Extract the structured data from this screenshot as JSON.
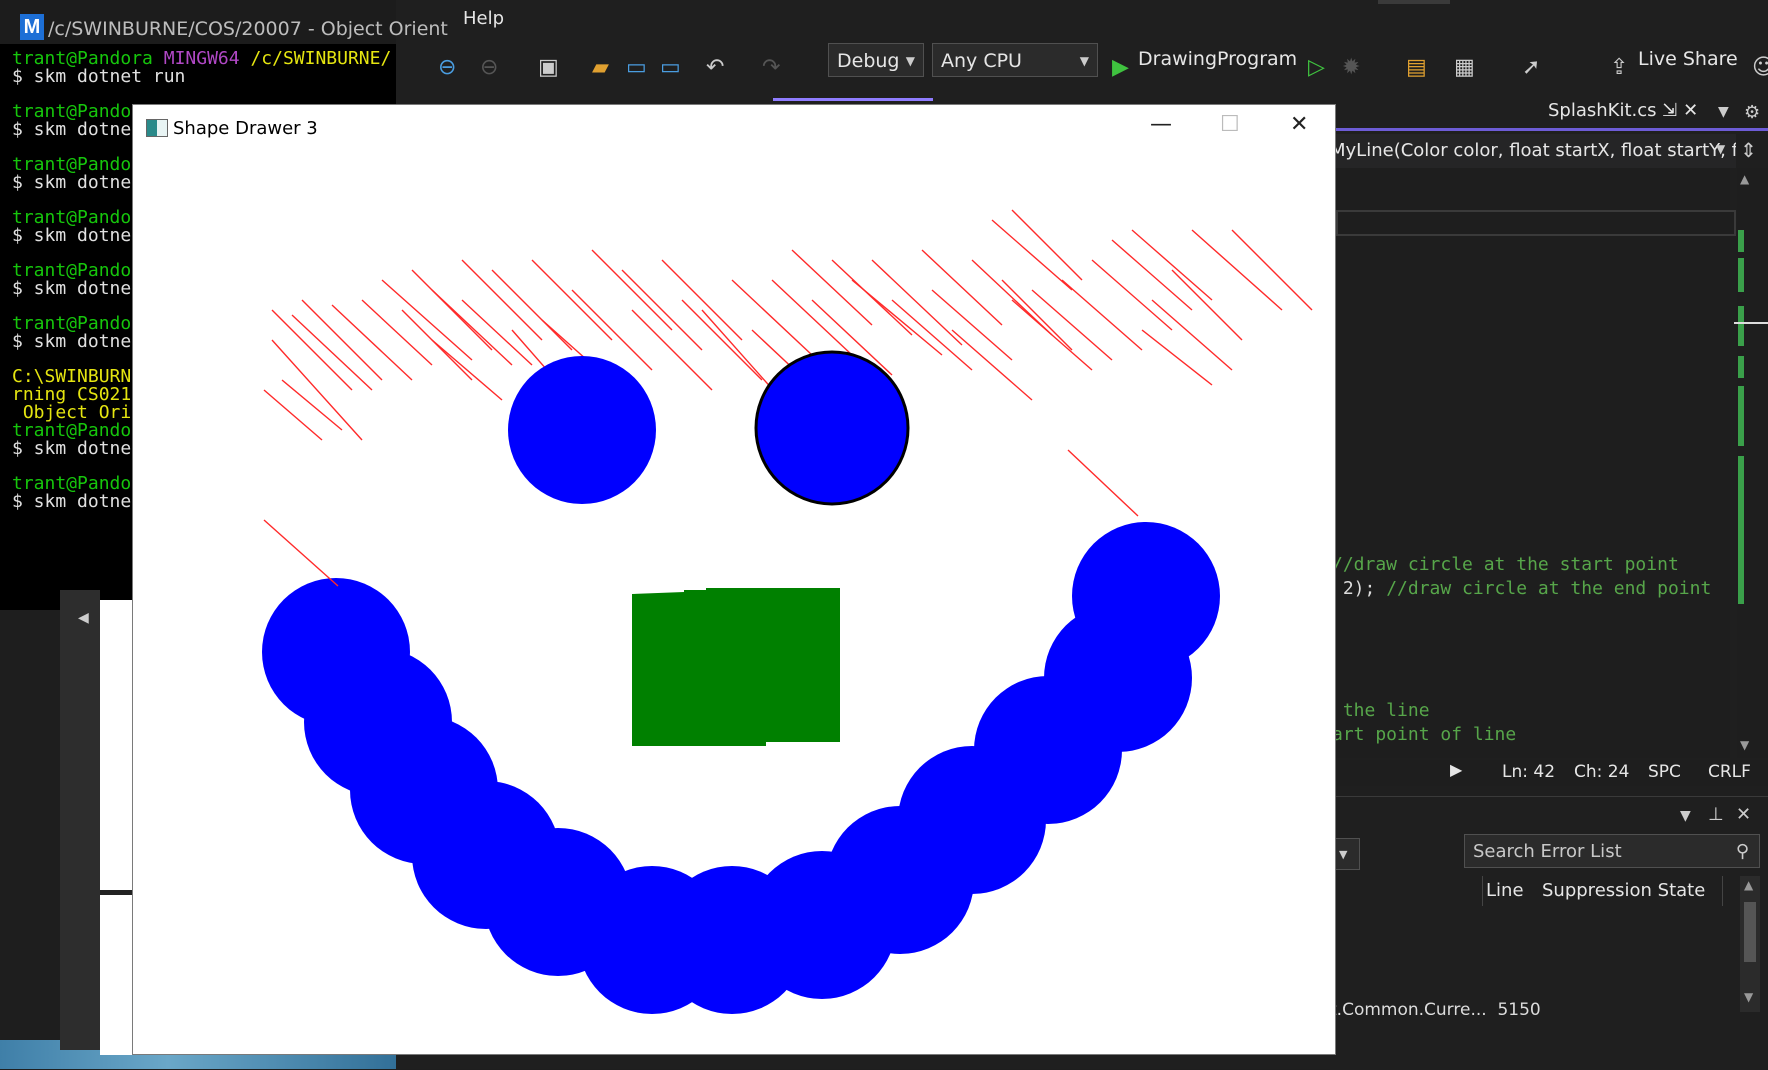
{
  "terminal": {
    "title": "/c/SWINBURNE/COS/20007 - Object Orient",
    "icon": "mingw-icon",
    "lines": [
      {
        "user": "trant@Pandora",
        "env": "MINGW64",
        "path": "/c/SWINBURNE/"
      },
      {
        "cmd": "$ skm dotnet run"
      },
      {
        "user": "trant@Pando"
      },
      {
        "cmd": "$ skm dotne"
      },
      {
        "user": "trant@Pando"
      },
      {
        "cmd": "$ skm dotne"
      },
      {
        "user": "trant@Pando"
      },
      {
        "cmd": "$ skm dotne"
      },
      {
        "user": "trant@Pando"
      },
      {
        "cmd": "$ skm dotne"
      },
      {
        "user": "trant@Pando"
      },
      {
        "cmd": "$ skm dotne"
      },
      {
        "warn": "C:\\SWINBURN"
      },
      {
        "warn": "rning CS021"
      },
      {
        "warn": " Object Ori"
      },
      {
        "user": "trant@Pando"
      },
      {
        "cmd": "$ skm dotne"
      },
      {
        "user": "trant@Pando"
      },
      {
        "cmd": "$ skm dotne"
      }
    ]
  },
  "vs": {
    "menu_help": "Help",
    "config": "Debug",
    "platform": "Any CPU",
    "startup_project": "DrawingProgram",
    "live_share": "Live Share",
    "file_tab": "SplashKit.cs",
    "nav_member": "MyLine(Color color, float startX, float startY, float",
    "code_lines": [
      {
        "prefix": "",
        "comment": "//draw circle at the start point"
      },
      {
        "prefix": " 2); ",
        "comment": "//draw circle at the end point"
      },
      {
        "prefix": "",
        "comment": " the line"
      },
      {
        "prefix": "",
        "comment": "art point of line"
      }
    ],
    "status": {
      "ln": "Ln: 42",
      "ch": "Ch: 24",
      "spc": "SPC",
      "crlf": "CRLF"
    },
    "error_list": {
      "search_placeholder": "Search Error List",
      "col_line": "Line",
      "col_suppression": "Suppression State",
      "row_text": "t.Common.Curre...",
      "row_line": "5150"
    }
  },
  "app": {
    "title": "Shape Drawer 3"
  }
}
